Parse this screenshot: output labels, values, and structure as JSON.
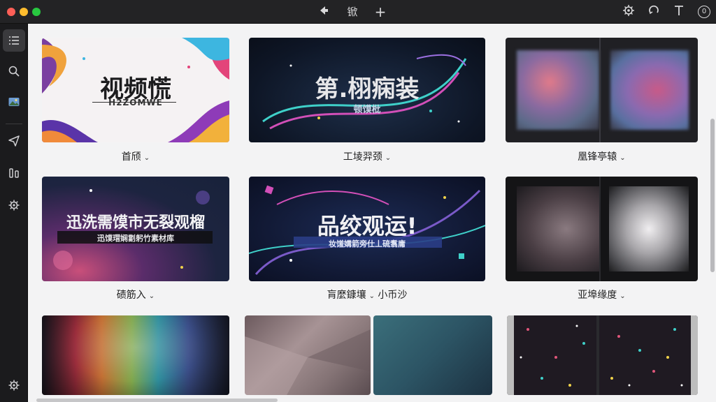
{
  "toolbar": {
    "back_icon": "back-arrow-icon",
    "title_glyph": "锨",
    "add_label": "+",
    "right_icons": [
      "settings-badge-icon",
      "sync-icon",
      "text-tool-icon",
      "account-icon"
    ],
    "account_badge": "0"
  },
  "sidebar": {
    "items": [
      {
        "name": "list",
        "icon": "list-icon",
        "active": true
      },
      {
        "name": "search",
        "icon": "search-icon",
        "active": false
      },
      {
        "name": "media",
        "icon": "image-icon",
        "active": false
      },
      {
        "name": "send",
        "icon": "send-icon",
        "active": false
      },
      {
        "name": "compare",
        "icon": "compare-icon",
        "active": false
      },
      {
        "name": "settings",
        "icon": "gear-icon",
        "active": false
      }
    ],
    "bottom_icon": "gear-icon"
  },
  "cards": [
    {
      "title_main": "视频慌",
      "subtitle": "H2ZOMWE",
      "label": "首颀"
    },
    {
      "title_main": "第.栩痫装",
      "subtitle": "顿馍枇",
      "label": "工堎羿颈"
    },
    {
      "title_main": "",
      "subtitle": "",
      "label": "凰锋亭辕"
    },
    {
      "title_main": "迅洗需馍市无裂观榴",
      "subtitle": "迅馍瑁娴劏躬竹素材库",
      "label": "碛筋入"
    },
    {
      "title_main": "品绞观运!",
      "subtitle": "妆馐媾箭旁仕丄硫翥庸",
      "label": "肓麼鏮壤",
      "label_extra": "小币沙"
    },
    {
      "title_main": "",
      "subtitle": "",
      "label": "亚埠缘度"
    },
    {
      "title_main": "",
      "subtitle": "",
      "label": ""
    },
    {
      "title_main": "",
      "subtitle": "",
      "label": ""
    },
    {
      "title_main": "",
      "subtitle": "",
      "label": ""
    },
    {
      "title_main": "",
      "subtitle": "",
      "label": ""
    }
  ],
  "colors": {
    "window_bg": "#1e1e20",
    "content_bg": "#f3f3f4",
    "sidebar_bg": "#1b1b1d",
    "accent_teal": "#3fd0c9",
    "accent_magenta": "#d24fb8"
  }
}
